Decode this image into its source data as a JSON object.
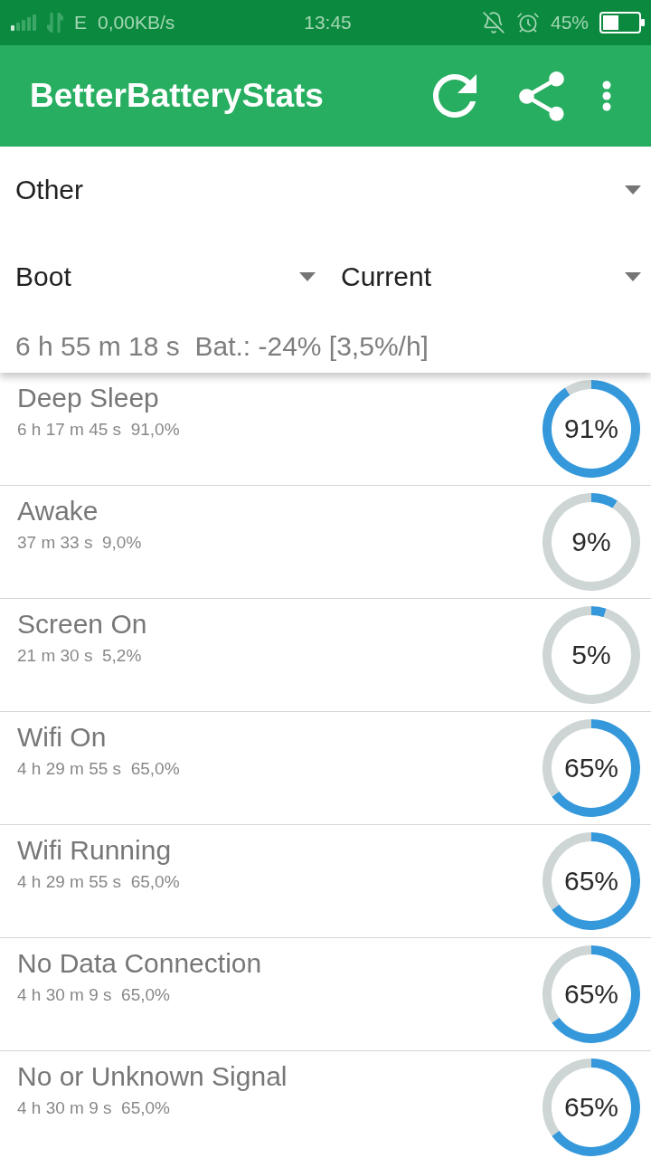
{
  "status_bar": {
    "network_type": "E",
    "data_rate": "0,00KB/s",
    "time": "13:45",
    "battery_percent": "45%"
  },
  "app_bar": {
    "title": "BetterBatteryStats"
  },
  "dropdown_rows": [
    {
      "dropdowns": [
        {
          "value": "Other"
        }
      ]
    },
    {
      "dropdowns": [
        {
          "value": "Boot"
        },
        {
          "value": "Current"
        }
      ]
    }
  ],
  "summary": "6 h 55 m 18 s  Bat.: -24% [3,5%/h]",
  "stats": [
    {
      "name": "Deep Sleep",
      "detail": "6 h 17 m 45 s  91,0%",
      "percent": "91%",
      "chart_data": {
        "type": "donut",
        "values": [
          91,
          9
        ]
      }
    },
    {
      "name": "Awake",
      "detail": "37 m 33 s  9,0%",
      "percent": "9%",
      "chart_data": {
        "type": "donut",
        "values": [
          9,
          91
        ]
      }
    },
    {
      "name": "Screen On",
      "detail": "21 m 30 s  5,2%",
      "percent": "5%",
      "chart_data": {
        "type": "donut",
        "values": [
          5,
          95
        ]
      }
    },
    {
      "name": "Wifi On",
      "detail": "4 h 29 m 55 s  65,0%",
      "percent": "65%",
      "chart_data": {
        "type": "donut",
        "values": [
          65,
          35
        ]
      }
    },
    {
      "name": "Wifi Running",
      "detail": "4 h 29 m 55 s  65,0%",
      "percent": "65%",
      "chart_data": {
        "type": "donut",
        "values": [
          65,
          35
        ]
      }
    },
    {
      "name": "No Data Connection",
      "detail": "4 h 30 m 9 s  65,0%",
      "percent": "65%",
      "chart_data": {
        "type": "donut",
        "values": [
          65,
          35
        ]
      }
    },
    {
      "name": "No or Unknown Signal",
      "detail": "4 h 30 m 9 s  65,0%",
      "percent": "65%",
      "chart_data": {
        "type": "donut",
        "values": [
          65,
          35
        ]
      }
    }
  ]
}
